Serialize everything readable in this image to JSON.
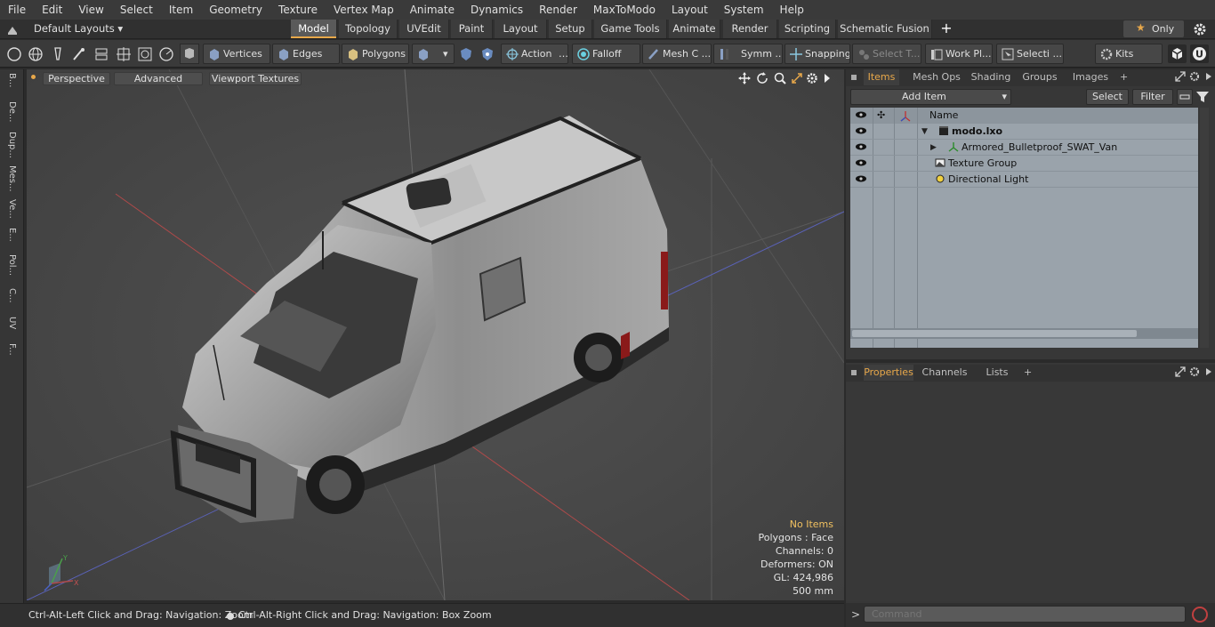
{
  "menu": [
    "File",
    "Edit",
    "View",
    "Select",
    "Item",
    "Geometry",
    "Texture",
    "Vertex Map",
    "Animate",
    "Dynamics",
    "Render",
    "MaxToModo",
    "Layout",
    "System",
    "Help"
  ],
  "layouts": {
    "default_label": "Default Layouts ▾",
    "tabs": [
      "Model",
      "Topology",
      "UVEdit",
      "Paint",
      "Layout",
      "Setup",
      "Game Tools",
      "Animate",
      "Render",
      "Scripting",
      "Schematic Fusion"
    ],
    "active_tab": "Model",
    "add": "+",
    "only_label": "Only"
  },
  "toolbar": {
    "vertices": "Vertices",
    "edges": "Edges",
    "polygons": "Polygons",
    "action": "Action",
    "falloff": "Falloff",
    "mesh": "Mesh C ...",
    "symmetry": "Symm ...",
    "snapping": "Snapping",
    "select_t": "Select T...",
    "work_plane": "Work Pl...",
    "selection": "Selecti ...",
    "kits": "Kits"
  },
  "left_tabs": [
    "B...",
    "De...",
    "Dup...",
    "Mes...",
    "Ve...",
    "E...",
    "Pol...",
    "C...",
    "UV",
    "F..."
  ],
  "viewport": {
    "view_mode": "Perspective",
    "shading": "Advanced",
    "textures": "Viewport Textures",
    "stats": {
      "items": "No Items",
      "polygons": "Polygons : Face",
      "channels": "Channels: 0",
      "deformers": "Deformers: ON",
      "gl": "GL: 424,986",
      "units": "500 mm"
    },
    "axis_labels": {
      "y": "Y",
      "x": "X"
    }
  },
  "status": {
    "hint1": "Ctrl-Alt-Left Click and Drag: Navigation: Zoom",
    "hint2": "Ctrl-Alt-Right Click and Drag: Navigation: Box Zoom"
  },
  "items_panel": {
    "tabs": [
      "Items",
      "Mesh Ops",
      "Shading",
      "Groups",
      "Images"
    ],
    "active_tab": "Items",
    "add_item": "Add Item",
    "select": "Select",
    "filter": "Filter",
    "column_name": "Name",
    "rows": [
      {
        "label": "modo.lxo",
        "bold": true
      },
      {
        "label": "Armored_Bulletproof_SWAT_Van"
      },
      {
        "label": "Texture Group"
      },
      {
        "label": "Directional Light"
      }
    ]
  },
  "props_panel": {
    "tabs": [
      "Properties",
      "Channels",
      "Lists"
    ],
    "active_tab": "Properties"
  },
  "command": {
    "placeholder": "Command",
    "prompt": ">"
  },
  "colors": {
    "accent": "#e8a84a",
    "list_bg": "#9aa3ab",
    "viewport_bg": "#4b4b4b",
    "stats_highlight": "#f0c060"
  }
}
